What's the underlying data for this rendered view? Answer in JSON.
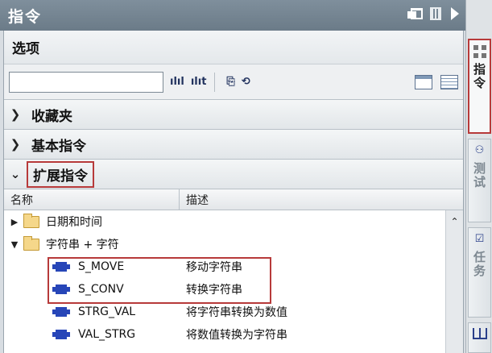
{
  "window": {
    "title": "指令"
  },
  "options": {
    "label": "选项"
  },
  "toolbar": {
    "search_placeholder": "",
    "icons": [
      "filter-down-icon",
      "filter-up-icon",
      "insert-icon",
      "reset-icon",
      "single-view-icon",
      "list-view-icon"
    ],
    "icon_glyphs": [
      "ılıl",
      "ılıt",
      "⎘",
      "⟲"
    ]
  },
  "sections": [
    {
      "label": "收藏夹",
      "expanded": false
    },
    {
      "label": "基本指令",
      "expanded": false
    },
    {
      "label": "扩展指令",
      "expanded": true
    }
  ],
  "table": {
    "columns": [
      "名称",
      "描述"
    ],
    "rows": [
      {
        "name": "日期和时间",
        "desc": "",
        "type": "folder",
        "expanded": false
      },
      {
        "name": "字符串 + 字符",
        "desc": "",
        "type": "folder",
        "expanded": true
      },
      {
        "name": "S_MOVE",
        "desc": "移动字符串",
        "type": "instruction"
      },
      {
        "name": "S_CONV",
        "desc": "转换字符串",
        "type": "instruction"
      },
      {
        "name": "STRG_VAL",
        "desc": "将字符串转换为数值",
        "type": "instruction"
      },
      {
        "name": "VAL_STRG",
        "desc": "将数值转换为字符串",
        "type": "instruction"
      }
    ]
  },
  "side_tabs": [
    {
      "label": "指令",
      "active": true
    },
    {
      "label": "测试",
      "active": false
    },
    {
      "label": "任务",
      "active": false
    }
  ],
  "colors": {
    "highlight": "#b73a3a",
    "title_bg": "#6b7b88",
    "instruction_blue": "#2746b8",
    "folder": "#f5d78a"
  }
}
